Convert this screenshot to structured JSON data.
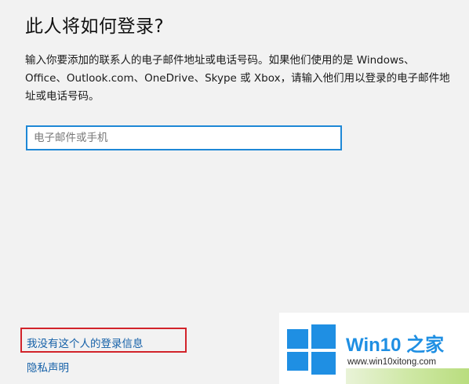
{
  "dialog": {
    "title": "此人将如何登录?",
    "description": "输入你要添加的联系人的电子邮件地址或电话号码。如果他们使用的是 Windows、Office、Outlook.com、OneDrive、Skype 或 Xbox，请输入他们用以登录的电子邮件地址或电话号码。",
    "email_input": {
      "value": "",
      "placeholder": "电子邮件或手机"
    },
    "links": {
      "no_sign_in_info": "我没有这个人的登录信息",
      "privacy": "隐私声明"
    }
  },
  "watermark": {
    "brand_prefix": "Win10",
    "brand_suffix": "之家",
    "url": "www.win10xitong.com",
    "logo_icon": "windows-logo-icon"
  },
  "colors": {
    "background": "#f2f2f2",
    "accent_blue": "#1e88d6",
    "link_blue": "#1460a8",
    "highlight_red": "#d2232a"
  }
}
